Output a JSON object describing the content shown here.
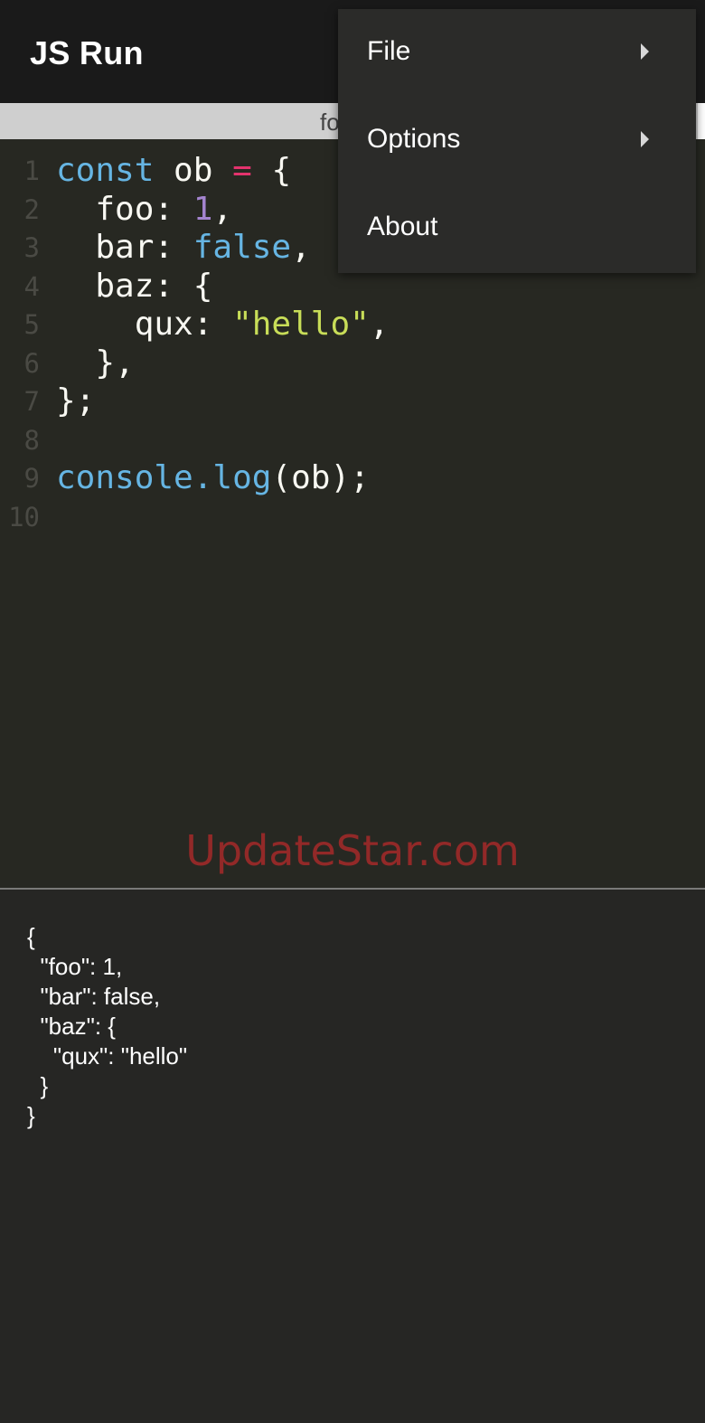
{
  "app": {
    "title": "JS Run"
  },
  "tab_strip": {
    "visible_label": "fo"
  },
  "editor": {
    "lines": [
      {
        "number": "1",
        "tokens": [
          {
            "text": "const",
            "kind": "keyword"
          },
          {
            "text": " ob ",
            "kind": "plain"
          },
          {
            "text": "=",
            "kind": "operator"
          },
          {
            "text": " {",
            "kind": "plain"
          }
        ]
      },
      {
        "number": "2",
        "tokens": [
          {
            "text": "  foo: ",
            "kind": "plain"
          },
          {
            "text": "1",
            "kind": "number"
          },
          {
            "text": ",",
            "kind": "plain"
          }
        ]
      },
      {
        "number": "3",
        "tokens": [
          {
            "text": "  bar: ",
            "kind": "plain"
          },
          {
            "text": "false",
            "kind": "bool"
          },
          {
            "text": ",",
            "kind": "plain"
          }
        ]
      },
      {
        "number": "4",
        "tokens": [
          {
            "text": "  baz: {",
            "kind": "plain"
          }
        ]
      },
      {
        "number": "5",
        "tokens": [
          {
            "text": "    qux: ",
            "kind": "plain"
          },
          {
            "text": "\"hello\"",
            "kind": "string"
          },
          {
            "text": ",",
            "kind": "plain"
          }
        ]
      },
      {
        "number": "6",
        "tokens": [
          {
            "text": "  },",
            "kind": "plain"
          }
        ]
      },
      {
        "number": "7",
        "tokens": [
          {
            "text": "};",
            "kind": "plain"
          }
        ]
      },
      {
        "number": "8",
        "tokens": []
      },
      {
        "number": "9",
        "tokens": [
          {
            "text": "console.log",
            "kind": "fn"
          },
          {
            "text": "(ob);",
            "kind": "plain"
          }
        ]
      },
      {
        "number": "10",
        "tokens": []
      }
    ],
    "watermark": "UpdateStar.com"
  },
  "console": {
    "lines": [
      "{",
      "  \"foo\": 1,",
      "  \"bar\": false,",
      "  \"baz\": {",
      "    \"qux\": \"hello\"",
      "  }",
      "}"
    ]
  },
  "menu": {
    "items": [
      {
        "label": "File",
        "has_submenu": true
      },
      {
        "label": "Options",
        "has_submenu": true
      },
      {
        "label": "About",
        "has_submenu": false
      }
    ]
  },
  "colors": {
    "keyword": "#66b5e3",
    "operator": "#e3336d",
    "number": "#a484cf",
    "string": "#c8dd58",
    "watermark": "#a52a2a"
  }
}
